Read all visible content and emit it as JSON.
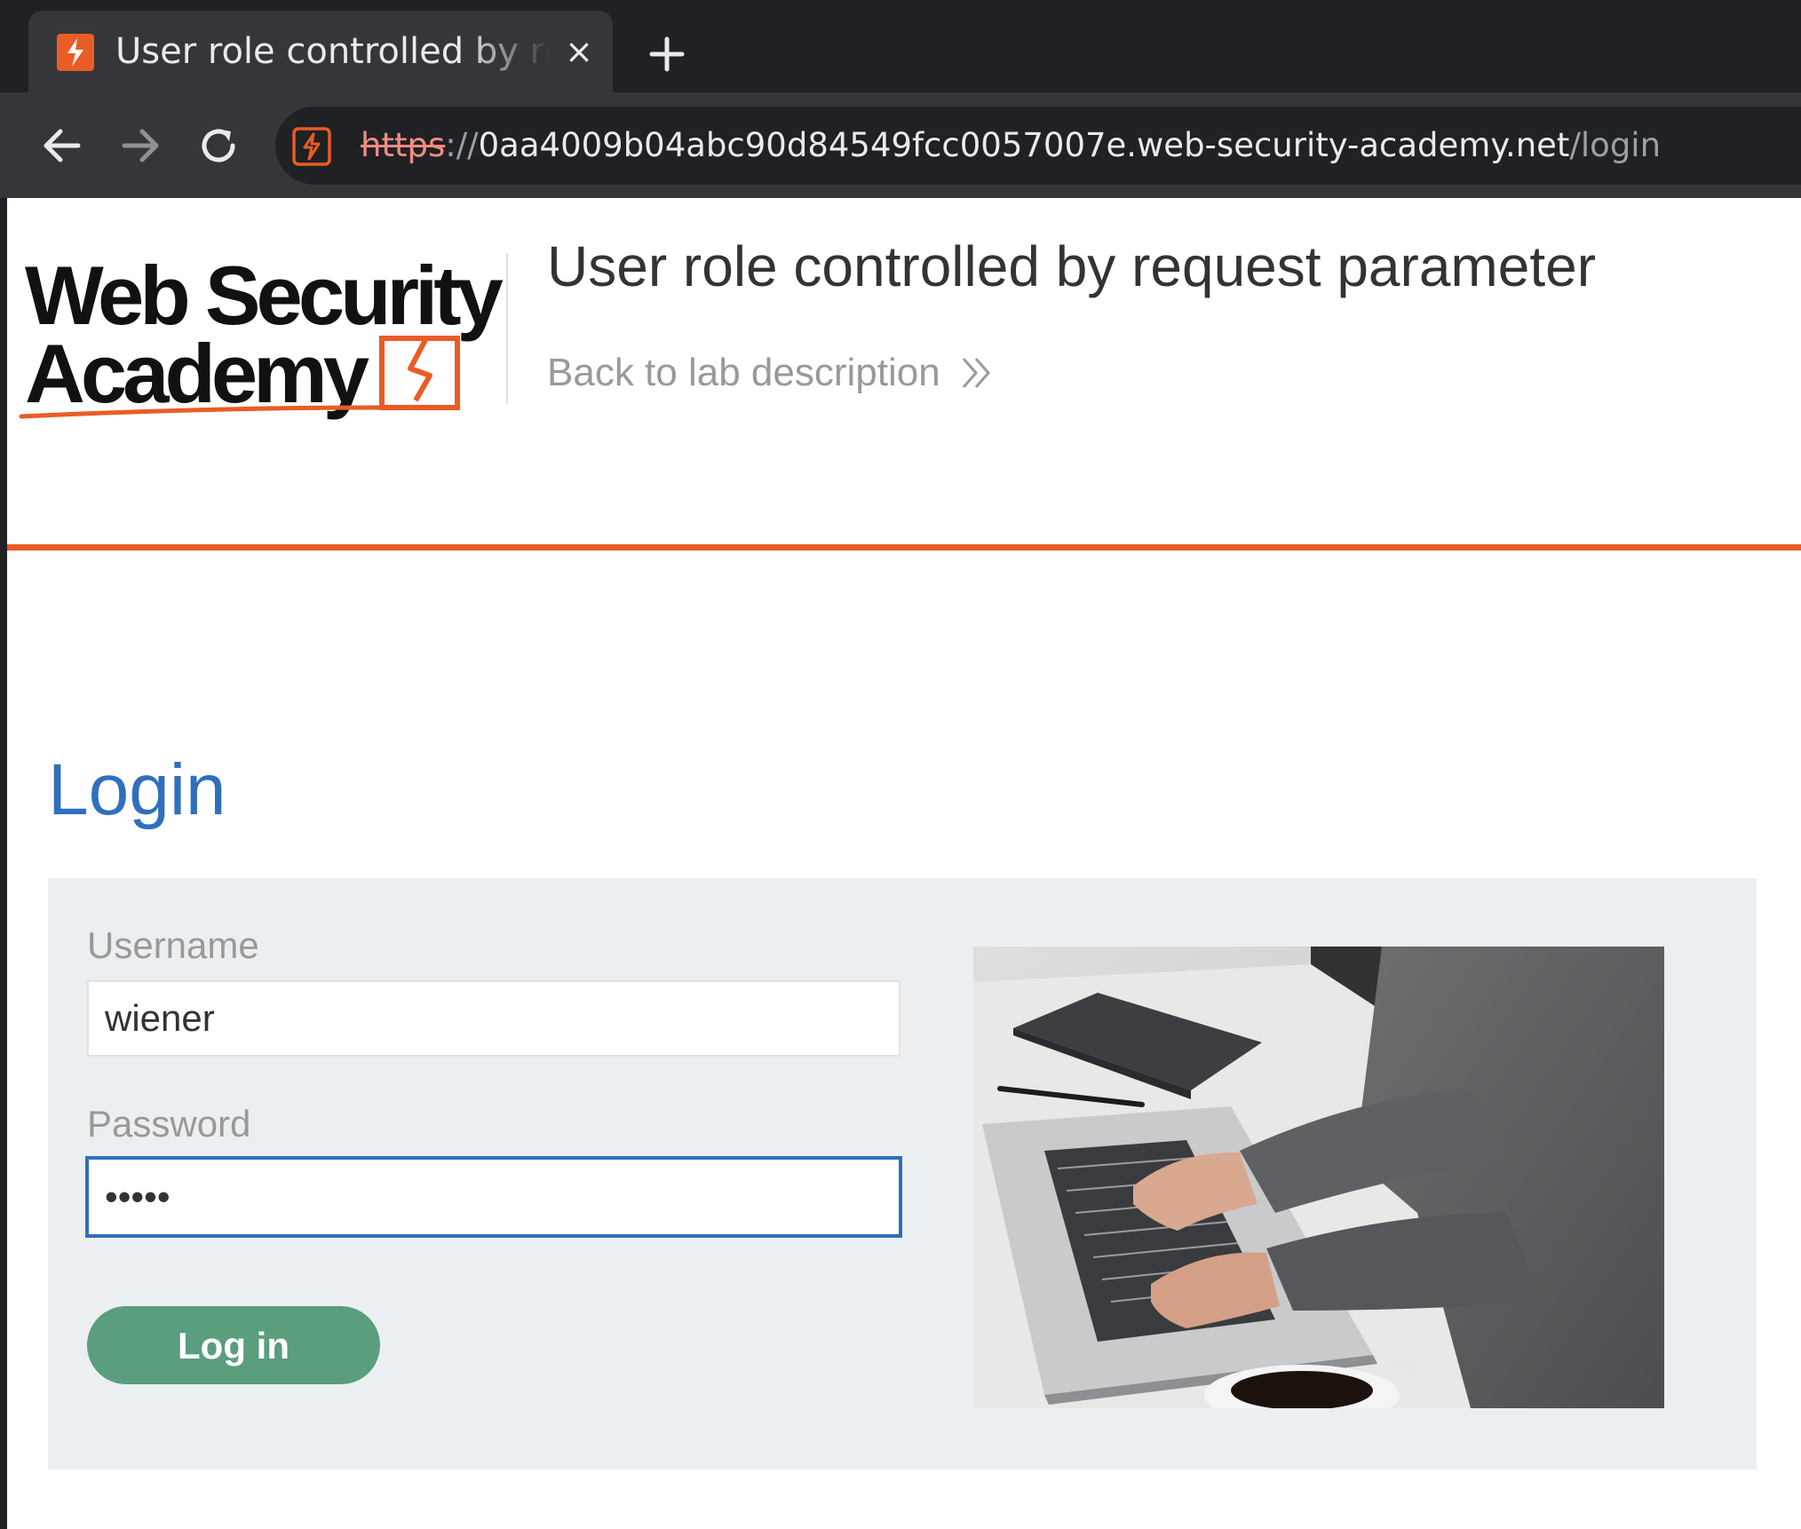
{
  "browser": {
    "tab": {
      "title": "User role controlled by request parameter",
      "close_symbol": "×"
    },
    "address_bar": {
      "scheme": "https",
      "separator": "://",
      "host": "0aa4009b04abc90d84549fcc0057007e.web-security-academy.net",
      "path": "/login"
    }
  },
  "header": {
    "logo_line1": "Web Security",
    "logo_line2": "Academy",
    "lab_title": "User role controlled by request parameter",
    "back_link": "Back to lab description"
  },
  "login": {
    "heading": "Login",
    "username_label": "Username",
    "username_value": "wiener",
    "password_label": "Password",
    "password_value": "•••••",
    "submit_label": "Log in"
  },
  "colors": {
    "accent_orange": "#ea5c25",
    "heading_blue": "#2f6fbd",
    "button_green": "#5a9e7e",
    "panel_grey": "#eceff2"
  },
  "icons": [
    "portswigger-favicon",
    "close-icon",
    "plus-icon",
    "back-arrow-icon",
    "forward-arrow-icon",
    "reload-icon",
    "site-info-icon",
    "double-chevron-right-icon"
  ]
}
